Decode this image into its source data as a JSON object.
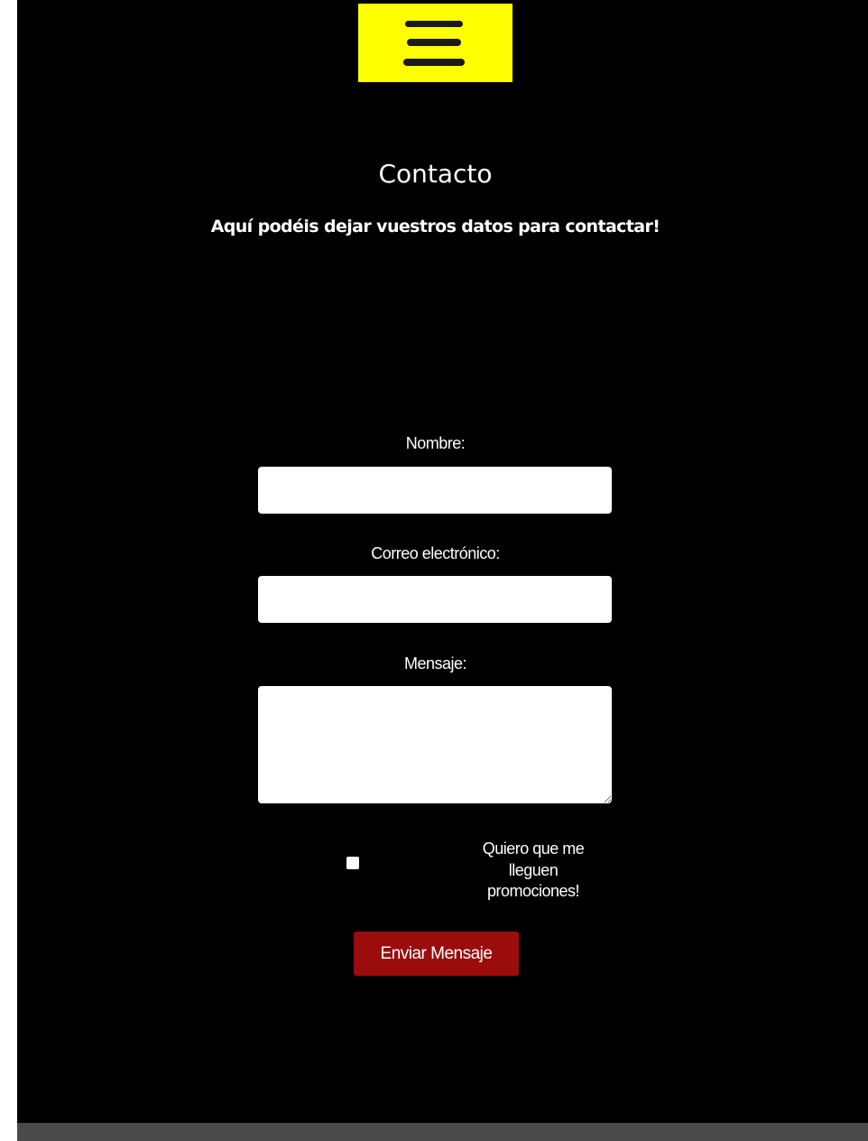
{
  "header": {
    "menu_icon": "hamburger-menu-icon",
    "menu_bg_color": "#ffff00"
  },
  "main": {
    "title": "Contacto",
    "subtitle": "Aquí podéis dejar vuestros datos para contactar!"
  },
  "form": {
    "name_label": "Nombre:",
    "name_value": "",
    "email_label": "Correo electrónico:",
    "email_value": "",
    "message_label": "Mensaje:",
    "message_value": "",
    "promo_checked": false,
    "promo_label_line1": "Quiero que me",
    "promo_label_line2": "lleguen",
    "promo_label_line3": "promociones!",
    "submit_label": "Enviar Mensaje",
    "submit_color": "#9b0c0c"
  },
  "colors": {
    "background": "#000000",
    "footer": "#4a4a4a",
    "text": "#ffffff"
  }
}
